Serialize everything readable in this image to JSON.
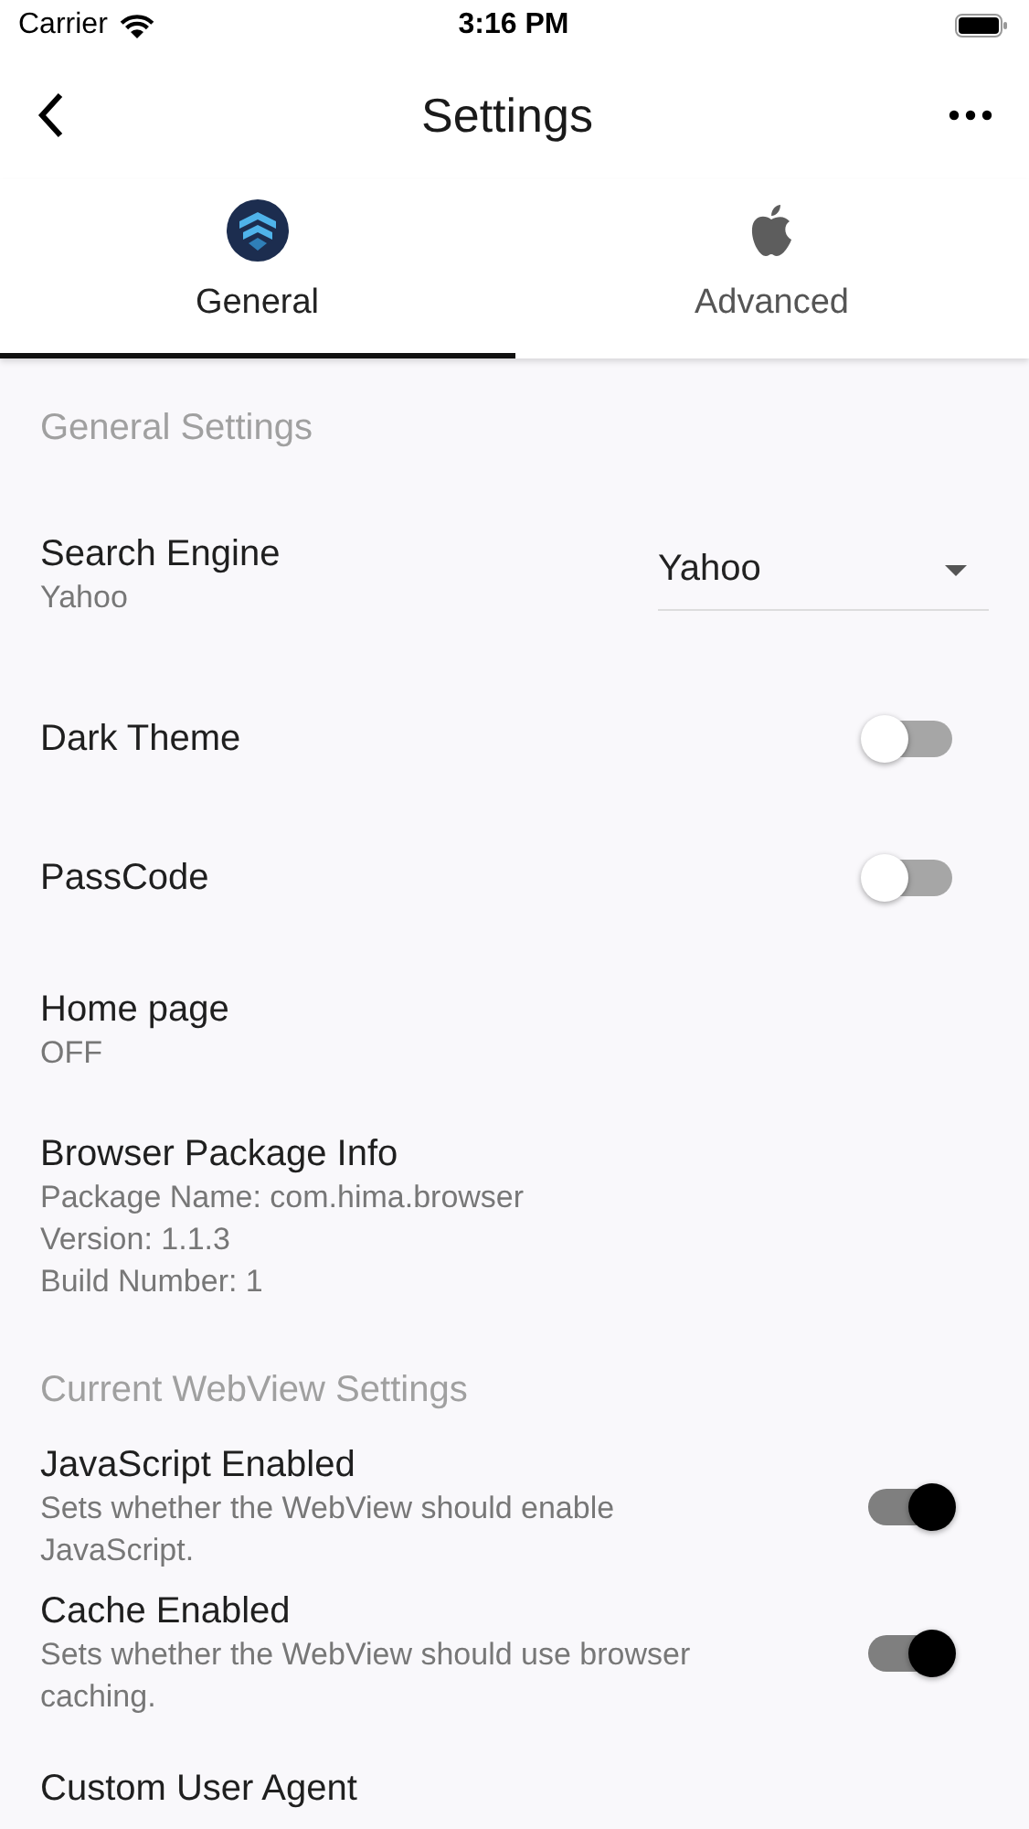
{
  "status_bar": {
    "carrier": "Carrier",
    "time": "3:16 PM"
  },
  "app_bar": {
    "title": "Settings"
  },
  "tabs": [
    {
      "label": "General",
      "selected": true
    },
    {
      "label": "Advanced",
      "selected": false
    }
  ],
  "settings": [
    {
      "kind": "header",
      "title": "General Settings"
    },
    {
      "kind": "dropdown",
      "title": "Search Engine",
      "subtitle": "Yahoo",
      "value": "Yahoo"
    },
    {
      "kind": "switch",
      "title": "Dark Theme",
      "on": false
    },
    {
      "kind": "switch",
      "title": "PassCode",
      "on": false
    },
    {
      "kind": "info",
      "title": "Home page",
      "lines": [
        "OFF"
      ]
    },
    {
      "kind": "info",
      "title": "Browser Package Info",
      "lines": [
        "Package Name: com.hima.browser",
        "Version: 1.1.3",
        "Build Number: 1"
      ]
    },
    {
      "kind": "header",
      "title": "Current WebView Settings"
    },
    {
      "kind": "switch",
      "title": "JavaScript Enabled",
      "subtitle": "Sets whether the WebView should enable JavaScript.",
      "on": true
    },
    {
      "kind": "switch",
      "title": "Cache Enabled",
      "subtitle": "Sets whether the WebView should use browser caching.",
      "on": true
    },
    {
      "kind": "info",
      "title": "Custom User Agent"
    }
  ]
}
